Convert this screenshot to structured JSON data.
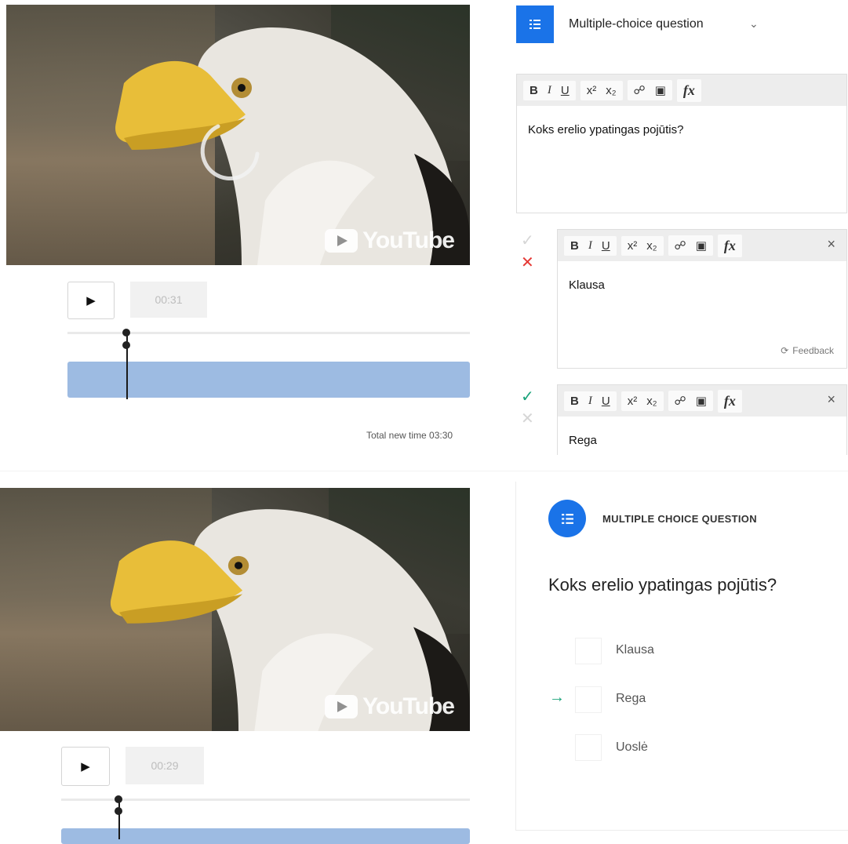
{
  "top_panel": {
    "video": {
      "brand": "YouTube",
      "loading_spinner": true
    },
    "controls": {
      "time": "00:31",
      "total_time_label": "Total new time 03:30"
    },
    "editor": {
      "type_icon": "list-icon",
      "type_label": "Multiple-choice question",
      "toolbar": {
        "bold": "B",
        "italic": "I",
        "underline": "U",
        "superscript": "x²",
        "subscript": "x₂",
        "formula": "fx"
      },
      "question_text": "Koks erelio ypatingas pojūtis?",
      "answers": [
        {
          "text": "Klausa",
          "correct": false,
          "feedback_label": "Feedback"
        },
        {
          "text": "Rega",
          "correct": true
        }
      ]
    }
  },
  "bottom_panel": {
    "video": {
      "brand": "YouTube"
    },
    "controls": {
      "time": "00:29"
    },
    "preview": {
      "type_label": "MULTIPLE CHOICE QUESTION",
      "question_text": "Koks erelio ypatingas pojūtis?",
      "options": [
        "Klausa",
        "Rega",
        "Uoslė"
      ],
      "highlighted_option_index": 1
    }
  },
  "colors": {
    "accent": "#1a73e8",
    "track": "#9dbbe2",
    "correct": "#1aa37a",
    "incorrect": "#e53935"
  }
}
